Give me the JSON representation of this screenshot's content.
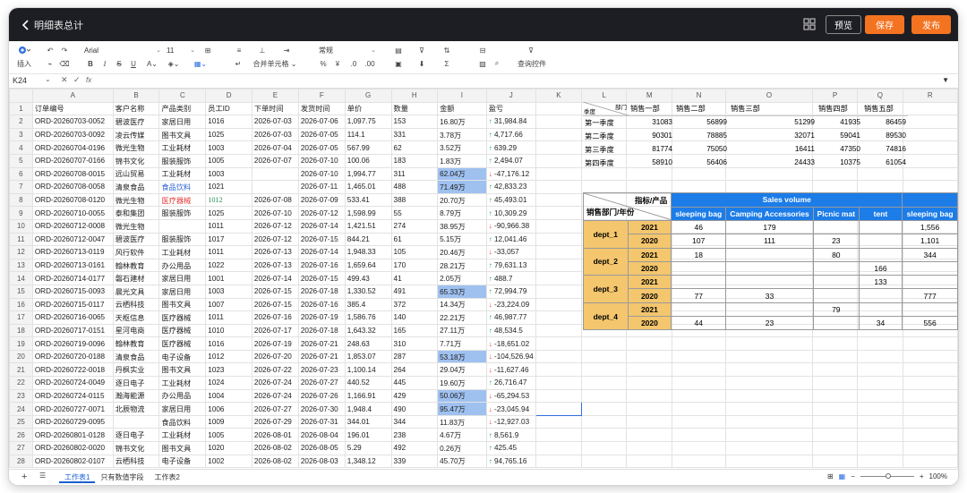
{
  "titlebar": {
    "title": "明细表总计",
    "preview": "预览",
    "save": "保存",
    "publish": "发布"
  },
  "toolbar": {
    "insert": "插入",
    "font": "Arial",
    "font_size": "11",
    "number_format": "常规",
    "merge": "合并单元格",
    "query": "查询控件"
  },
  "formula_bar": {
    "cell_ref": "K24",
    "fx": "fx",
    "value": ""
  },
  "colors": {
    "accent": "#f47320",
    "header_blue": "#1c7ce8",
    "pivot_yellow": "#f4c66d",
    "highlight": "#9fc1f0",
    "up": "#19a34a",
    "down": "#e53935"
  },
  "columns": [
    "A",
    "B",
    "C",
    "D",
    "E",
    "F",
    "G",
    "H",
    "I",
    "J",
    "K",
    "L",
    "M",
    "N",
    "O",
    "P",
    "Q",
    "R"
  ],
  "rows": [
    {
      "n": "1",
      "a": "订单编号",
      "b": "客户名称",
      "c": "产品类别",
      "d": "员工ID",
      "e": "下单时间",
      "f": "发货时间",
      "g": "单价",
      "h": "数量",
      "i": "金额",
      "j": "盈亏",
      "dir": ""
    },
    {
      "n": "2",
      "a": "ORD-20260703-0052",
      "b": "碧波医疗",
      "c": "家居日用",
      "d": "1016",
      "e": "2026-07-03",
      "f": "2026-07-06",
      "g": "1,097.75",
      "h": "153",
      "i": "16.80万",
      "j": "31,984.84",
      "dir": "up"
    },
    {
      "n": "3",
      "a": "ORD-20260703-0092",
      "b": "凌云传媒",
      "c": "图书文具",
      "d": "1025",
      "e": "2026-07-03",
      "f": "2026-07-05",
      "g": "114.1",
      "h": "331",
      "i": "3.78万",
      "j": "4,717.66",
      "dir": "up"
    },
    {
      "n": "4",
      "a": "ORD-20260704-0196",
      "b": "微光生物",
      "c": "工业耗材",
      "d": "1003",
      "e": "2026-07-04",
      "f": "2026-07-05",
      "g": "567.99",
      "h": "62",
      "i": "3.52万",
      "j": "639.29",
      "dir": "up"
    },
    {
      "n": "5",
      "a": "ORD-20260707-0166",
      "b": "锦书文化",
      "c": "服装服饰",
      "d": "1005",
      "e": "2026-07-07",
      "f": "2026-07-10",
      "g": "100.06",
      "h": "183",
      "i": "1.83万",
      "j": "2,494.07",
      "dir": "up"
    },
    {
      "n": "6",
      "a": "ORD-20260708-0015",
      "b": "远山贸易",
      "c": "工业耗材",
      "d": "1003",
      "e": "",
      "f": "2026-07-10",
      "g": "1,994.77",
      "h": "311",
      "i": "62.04万",
      "j": "-47,176.12",
      "dir": "down",
      "hl": true
    },
    {
      "n": "7",
      "a": "ORD-20260708-0058",
      "b": "清泉食品",
      "c": "食品饮料",
      "d": "1021",
      "e": "",
      "f": "2026-07-11",
      "g": "1,465.01",
      "h": "488",
      "i": "71.49万",
      "j": "42,833.23",
      "dir": "up",
      "hl": true,
      "cblue": true
    },
    {
      "n": "8",
      "a": "ORD-20260708-0120",
      "b": "微光生物",
      "c": "医疗器械",
      "d": "1012",
      "e": "2026-07-08",
      "f": "2026-07-09",
      "g": "533.41",
      "h": "388",
      "i": "20.70万",
      "j": "45,493.01",
      "dir": "up",
      "cred": true,
      "dgreen": true
    },
    {
      "n": "9",
      "a": "ORD-20260710-0055",
      "b": "泰和集团",
      "c": "服装服饰",
      "d": "1025",
      "e": "2026-07-10",
      "f": "2026-07-12",
      "g": "1,598.99",
      "h": "55",
      "i": "8.79万",
      "j": "10,309.29",
      "dir": "up"
    },
    {
      "n": "10",
      "a": "ORD-20260712-0008",
      "b": "微光生物",
      "c": "",
      "d": "1011",
      "e": "2026-07-12",
      "f": "2026-07-14",
      "g": "1,421.51",
      "h": "274",
      "i": "38.95万",
      "j": "-90,966.38",
      "dir": "down"
    },
    {
      "n": "11",
      "a": "ORD-20260712-0047",
      "b": "碧波医疗",
      "c": "服装服饰",
      "d": "1017",
      "e": "2026-07-12",
      "f": "2026-07-15",
      "g": "844.21",
      "h": "61",
      "i": "5.15万",
      "j": "12,041.46",
      "dir": "up"
    },
    {
      "n": "12",
      "a": "ORD-20260713-0119",
      "b": "风行软件",
      "c": "工业耗材",
      "d": "1011",
      "e": "2026-07-13",
      "f": "2026-07-14",
      "g": "1,948.33",
      "h": "105",
      "i": "20.46万",
      "j": "-33,057",
      "dir": "down"
    },
    {
      "n": "13",
      "a": "ORD-20260713-0161",
      "b": "翰林教育",
      "c": "办公用品",
      "d": "1022",
      "e": "2026-07-13",
      "f": "2026-07-16",
      "g": "1,659.64",
      "h": "170",
      "i": "28.21万",
      "j": "79,631.13",
      "dir": "up"
    },
    {
      "n": "14",
      "a": "ORD-20260714-0177",
      "b": "磐石建材",
      "c": "家居日用",
      "d": "1001",
      "e": "2026-07-14",
      "f": "2026-07-15",
      "g": "499.43",
      "h": "41",
      "i": "2.05万",
      "j": "488.7",
      "dir": "up"
    },
    {
      "n": "15",
      "a": "ORD-20260715-0093",
      "b": "晨光文具",
      "c": "家居日用",
      "d": "1003",
      "e": "2026-07-15",
      "f": "2026-07-18",
      "g": "1,330.52",
      "h": "491",
      "i": "65.33万",
      "j": "72,994.79",
      "dir": "up",
      "hl": true
    },
    {
      "n": "16",
      "a": "ORD-20260715-0117",
      "b": "云栖科技",
      "c": "图书文具",
      "d": "1007",
      "e": "2026-07-15",
      "f": "2026-07-16",
      "g": "385.4",
      "h": "372",
      "i": "14.34万",
      "j": "-23,224.09",
      "dir": "down"
    },
    {
      "n": "17",
      "a": "ORD-20260716-0065",
      "b": "天枢信息",
      "c": "医疗器械",
      "d": "1011",
      "e": "2026-07-16",
      "f": "2026-07-19",
      "g": "1,586.76",
      "h": "140",
      "i": "22.21万",
      "j": "46,987.77",
      "dir": "up"
    },
    {
      "n": "18",
      "a": "ORD-20260717-0151",
      "b": "星河电商",
      "c": "医疗器械",
      "d": "1010",
      "e": "2026-07-17",
      "f": "2026-07-18",
      "g": "1,643.32",
      "h": "165",
      "i": "27.11万",
      "j": "48,534.5",
      "dir": "up"
    },
    {
      "n": "19",
      "a": "ORD-20260719-0096",
      "b": "翰林教育",
      "c": "医疗器械",
      "d": "1016",
      "e": "2026-07-19",
      "f": "2026-07-21",
      "g": "248.63",
      "h": "310",
      "i": "7.71万",
      "j": "-18,651.02",
      "dir": "down"
    },
    {
      "n": "20",
      "a": "ORD-20260720-0188",
      "b": "清泉食品",
      "c": "电子设备",
      "d": "1012",
      "e": "2026-07-20",
      "f": "2026-07-21",
      "g": "1,853.07",
      "h": "287",
      "i": "53.18万",
      "j": "-104,526.94",
      "dir": "down",
      "hl": true
    },
    {
      "n": "21",
      "a": "ORD-20260722-0018",
      "b": "丹枫实业",
      "c": "图书文具",
      "d": "1023",
      "e": "2026-07-22",
      "f": "2026-07-23",
      "g": "1,100.14",
      "h": "264",
      "i": "29.04万",
      "j": "-11,627.46",
      "dir": "down"
    },
    {
      "n": "22",
      "a": "ORD-20260724-0049",
      "b": "逐日电子",
      "c": "工业耗材",
      "d": "1024",
      "e": "2026-07-24",
      "f": "2026-07-27",
      "g": "440.52",
      "h": "445",
      "i": "19.60万",
      "j": "26,716.47",
      "dir": "up"
    },
    {
      "n": "23",
      "a": "ORD-20260724-0115",
      "b": "瀚海能源",
      "c": "办公用品",
      "d": "1004",
      "e": "2026-07-24",
      "f": "2026-07-26",
      "g": "1,166.91",
      "h": "429",
      "i": "50.06万",
      "j": "-65,294.53",
      "dir": "down",
      "hl": true
    },
    {
      "n": "24",
      "a": "ORD-20260727-0071",
      "b": "北辰物流",
      "c": "家居日用",
      "d": "1006",
      "e": "2026-07-27",
      "f": "2026-07-30",
      "g": "1,948.4",
      "h": "490",
      "i": "95.47万",
      "j": "-23,045.94",
      "dir": "down",
      "hl": true
    },
    {
      "n": "25",
      "a": "ORD-20260729-0095",
      "b": "",
      "c": "食品饮料",
      "d": "1009",
      "e": "2026-07-29",
      "f": "2026-07-31",
      "g": "344.01",
      "h": "344",
      "i": "11.83万",
      "j": "-12,927.03",
      "dir": "down"
    },
    {
      "n": "26",
      "a": "ORD-20260801-0128",
      "b": "逐日电子",
      "c": "工业耗材",
      "d": "1005",
      "e": "2026-08-01",
      "f": "2026-08-04",
      "g": "196.01",
      "h": "238",
      "i": "4.67万",
      "j": "8,561.9",
      "dir": "up"
    },
    {
      "n": "27",
      "a": "ORD-20260802-0020",
      "b": "锦书文化",
      "c": "图书文具",
      "d": "1020",
      "e": "2026-08-02",
      "f": "2026-08-05",
      "g": "5.29",
      "h": "492",
      "i": "0.26万",
      "j": "425.45",
      "dir": "up"
    },
    {
      "n": "28",
      "a": "ORD-20260802-0107",
      "b": "云栖科技",
      "c": "电子设备",
      "d": "1002",
      "e": "2026-08-02",
      "f": "2026-08-03",
      "g": "1,348.12",
      "h": "339",
      "i": "45.70万",
      "j": "94,765.16",
      "dir": "up"
    }
  ],
  "quarter_table": {
    "corner_top": "部门",
    "corner_bottom": "季度",
    "headers": [
      "销售一部",
      "销售二部",
      "销售三部",
      "销售四部",
      "销售五部"
    ],
    "rows": [
      {
        "label": "第一季度",
        "values": [
          "31083",
          "56899",
          "51299",
          "41935",
          "86459"
        ]
      },
      {
        "label": "第二季度",
        "values": [
          "90301",
          "78885",
          "32071",
          "59041",
          "89530"
        ]
      },
      {
        "label": "第三季度",
        "values": [
          "81774",
          "75050",
          "16411",
          "47350",
          "74816"
        ]
      },
      {
        "label": "第四季度",
        "values": [
          "58910",
          "56406",
          "24433",
          "10375",
          "61054"
        ]
      }
    ]
  },
  "pivot": {
    "corner_top": "指标/产品",
    "corner_bottom": "销售部门/年份",
    "measure": "Sales volume",
    "products": [
      "sleeping bag",
      "Camping Accessories",
      "Picnic mat",
      "tent",
      "sleeping bag"
    ],
    "groups": [
      {
        "dept": "dept_1",
        "rows": [
          {
            "year": "2021",
            "values": [
              "46",
              "179",
              "",
              "",
              "1,556"
            ]
          },
          {
            "year": "2020",
            "values": [
              "107",
              "111",
              "23",
              "",
              "1,101"
            ]
          }
        ]
      },
      {
        "dept": "dept_2",
        "rows": [
          {
            "year": "2021",
            "values": [
              "18",
              "",
              "80",
              "",
              "344"
            ]
          },
          {
            "year": "2020",
            "values": [
              "",
              "",
              "",
              "166",
              ""
            ]
          }
        ]
      },
      {
        "dept": "dept_3",
        "rows": [
          {
            "year": "2021",
            "values": [
              "",
              "",
              "",
              "133",
              ""
            ]
          },
          {
            "year": "2020",
            "values": [
              "77",
              "33",
              "",
              "",
              "777"
            ]
          }
        ]
      },
      {
        "dept": "dept_4",
        "rows": [
          {
            "year": "2021",
            "values": [
              "",
              "",
              "79",
              "",
              ""
            ]
          },
          {
            "year": "2020",
            "values": [
              "44",
              "23",
              "",
              "34",
              "556"
            ]
          }
        ]
      }
    ]
  },
  "bottom": {
    "tabs": [
      "工作表1",
      "只有数值字段",
      "工作表2"
    ],
    "zoom": "100%"
  }
}
